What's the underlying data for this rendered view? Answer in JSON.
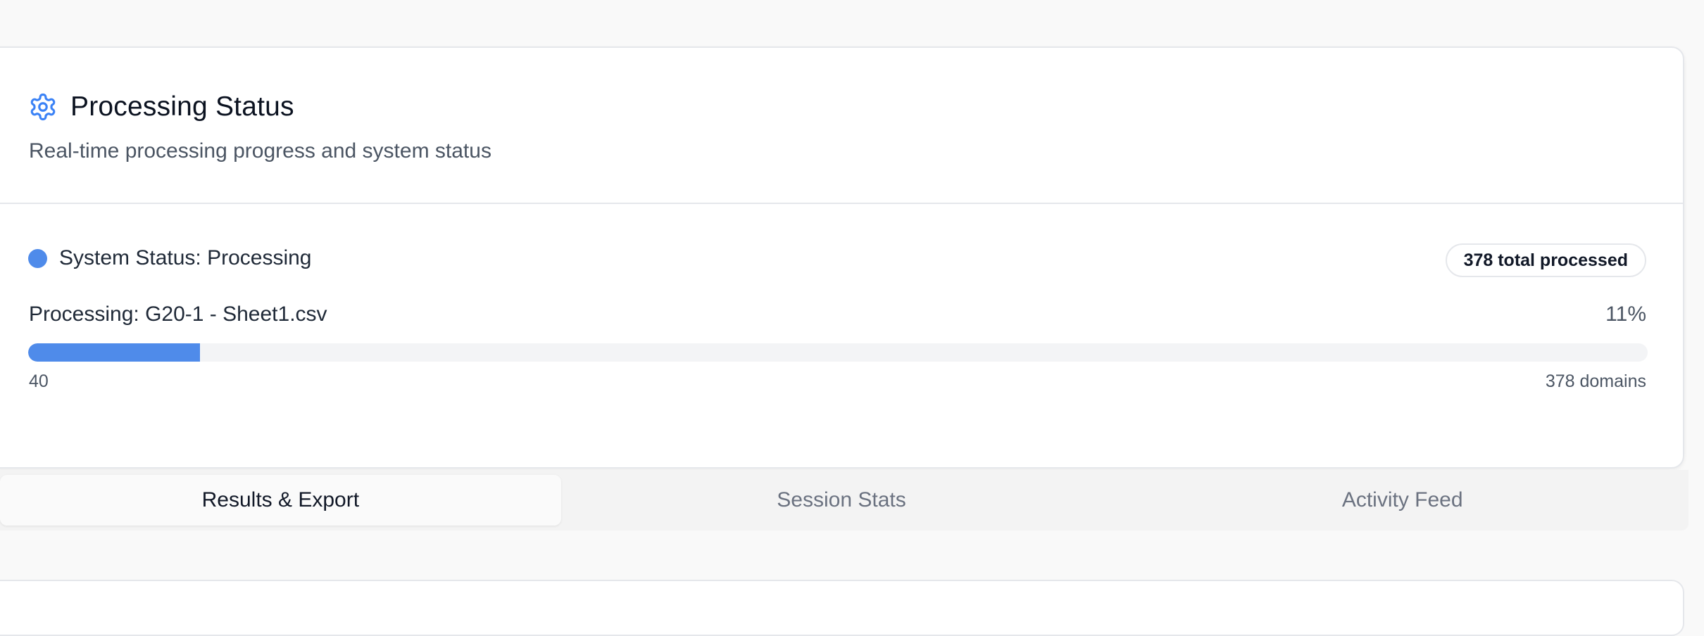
{
  "processing_card": {
    "title": "Processing Status",
    "subtitle": "Real-time processing progress and system status",
    "system_status": "System Status: Processing",
    "total_badge": "378 total processed",
    "current_file_label": "Processing: G20-1 - Sheet1.csv",
    "percent_label": "11%",
    "progress_fraction": 0.106,
    "processed_count": "40",
    "total_label": "378 domains"
  },
  "tabs": [
    {
      "label": "Results & Export",
      "active": true
    },
    {
      "label": "Session Stats",
      "active": false
    },
    {
      "label": "Activity Feed",
      "active": false
    }
  ],
  "colors": {
    "accent": "#4f8bea",
    "status_processing": "#4f8bea"
  },
  "icons": {
    "header": "gear-icon"
  }
}
